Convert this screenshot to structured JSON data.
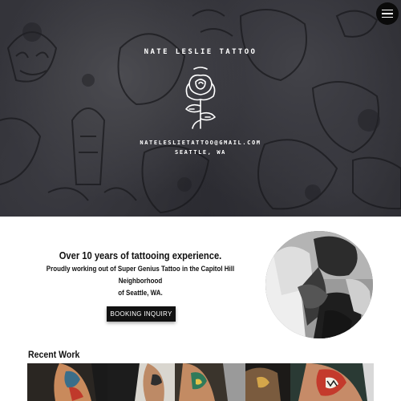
{
  "hero": {
    "brand": "NATE LESLIE TATTOO",
    "email": "NATELESLIETATTOO@GMAIL.COM",
    "location": "SEATTLE, WA"
  },
  "about": {
    "headline": "Over 10 years of tattooing experience.",
    "subline_1": "Proudly working out of Super Genius Tattoo in the Capitol Hill Neighborhood",
    "subline_2": "of Seattle, WA.",
    "booking_label": "BOOKING INQUIRY"
  },
  "recent": {
    "title": "Recent Work"
  },
  "icons": {
    "menu": "hamburger-menu-icon",
    "logo": "rose-logo-icon"
  },
  "colors": {
    "button_bg": "#111111",
    "hero_tint": "#3a3a42"
  }
}
